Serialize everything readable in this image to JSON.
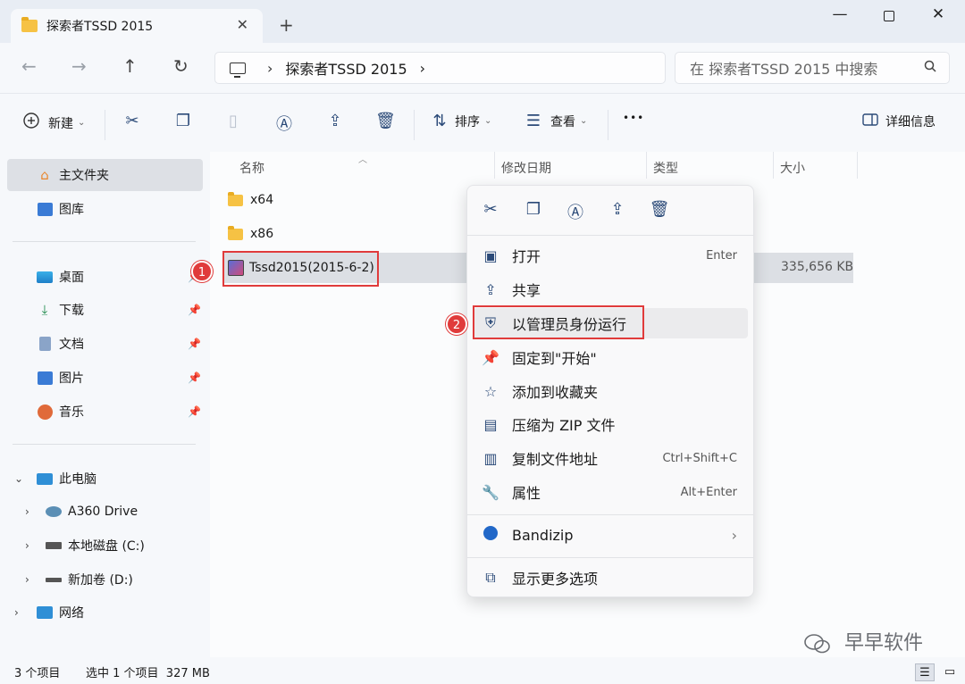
{
  "window": {
    "tab_title": "探索者TSSD 2015",
    "tab_close": "✕",
    "new_tab": "+",
    "min": "—",
    "close": "✕"
  },
  "nav": {
    "back": "←",
    "forward": "→",
    "up": "↑",
    "refresh": "↻",
    "crumb_sep1": "›",
    "crumb_sep2": "›",
    "breadcrumb": "探索者TSSD 2015",
    "search_placeholder": "在 探索者TSSD 2015 中搜索"
  },
  "toolbar": {
    "new_label": "新建",
    "sort_label": "排序",
    "view_label": "查看",
    "more_label": "•••",
    "details_label": "详细信息"
  },
  "sidebar": {
    "home": "主文件夹",
    "gallery": "图库",
    "desktop": "桌面",
    "downloads": "下载",
    "documents": "文档",
    "pictures": "图片",
    "music": "音乐",
    "this_pc": "此电脑",
    "a360": "A360 Drive",
    "local_c": "本地磁盘 (C:)",
    "new_d": "新加卷 (D:)",
    "network": "网络"
  },
  "columns": {
    "name": "名称",
    "modified": "修改日期",
    "type": "类型",
    "size": "大小"
  },
  "files": [
    {
      "name": "x64"
    },
    {
      "name": "x86"
    },
    {
      "name": "Tssd2015(2015-6-2)",
      "size": "335,656 KB"
    }
  ],
  "annotations": {
    "one": "1",
    "two": "2"
  },
  "context_menu": {
    "items": [
      {
        "label": "打开",
        "shortcut": "Enter"
      },
      {
        "label": "共享",
        "shortcut": ""
      },
      {
        "label": "以管理员身份运行",
        "shortcut": ""
      },
      {
        "label": "固定到\"开始\"",
        "shortcut": ""
      },
      {
        "label": "添加到收藏夹",
        "shortcut": ""
      },
      {
        "label": "压缩为 ZIP 文件",
        "shortcut": ""
      },
      {
        "label": "复制文件地址",
        "shortcut": "Ctrl+Shift+C"
      },
      {
        "label": "属性",
        "shortcut": "Alt+Enter"
      },
      {
        "label": "Bandizip",
        "shortcut": "›"
      },
      {
        "label": "显示更多选项",
        "shortcut": ""
      }
    ]
  },
  "status": {
    "count": "3 个项目",
    "selection": "选中 1 个项目  327 MB"
  },
  "watermark": "早早软件",
  "colors": {
    "accent": "#2b4a78",
    "annotation_red": "#e03b3b",
    "folder_yellow": "#f6c244"
  }
}
